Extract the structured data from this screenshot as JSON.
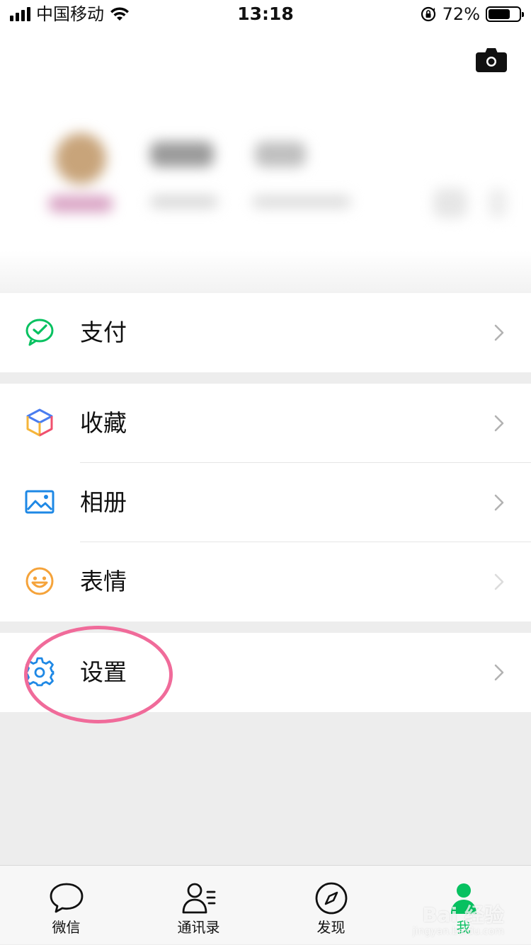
{
  "status_bar": {
    "carrier": "中国移动",
    "time": "13:18",
    "battery_percent": "72%",
    "battery_level": 0.72
  },
  "profile": {
    "camera_icon": "camera-icon"
  },
  "menu": {
    "groups": [
      {
        "items": [
          {
            "label": "支付",
            "icon": "wechat-pay-icon",
            "color": "#07c160"
          }
        ]
      },
      {
        "items": [
          {
            "label": "收藏",
            "icon": "favorites-cube-icon"
          },
          {
            "label": "相册",
            "icon": "album-image-icon",
            "color": "#1e88e5"
          },
          {
            "label": "表情",
            "icon": "sticker-smile-icon",
            "color": "#f5a33a"
          }
        ]
      },
      {
        "items": [
          {
            "label": "设置",
            "icon": "settings-gear-icon",
            "color": "#1e88e5"
          }
        ]
      }
    ]
  },
  "annotation": {
    "color": "#f06b9a"
  },
  "tabbar": {
    "tabs": [
      {
        "label": "微信",
        "icon": "chat-bubble-icon"
      },
      {
        "label": "通讯录",
        "icon": "contacts-icon"
      },
      {
        "label": "发现",
        "icon": "compass-icon"
      },
      {
        "label": "我",
        "icon": "me-person-icon",
        "active": true,
        "color": "#07c160"
      }
    ]
  },
  "watermark": {
    "main": "Bai 经验",
    "sub": "jingyan.baidu.com"
  }
}
